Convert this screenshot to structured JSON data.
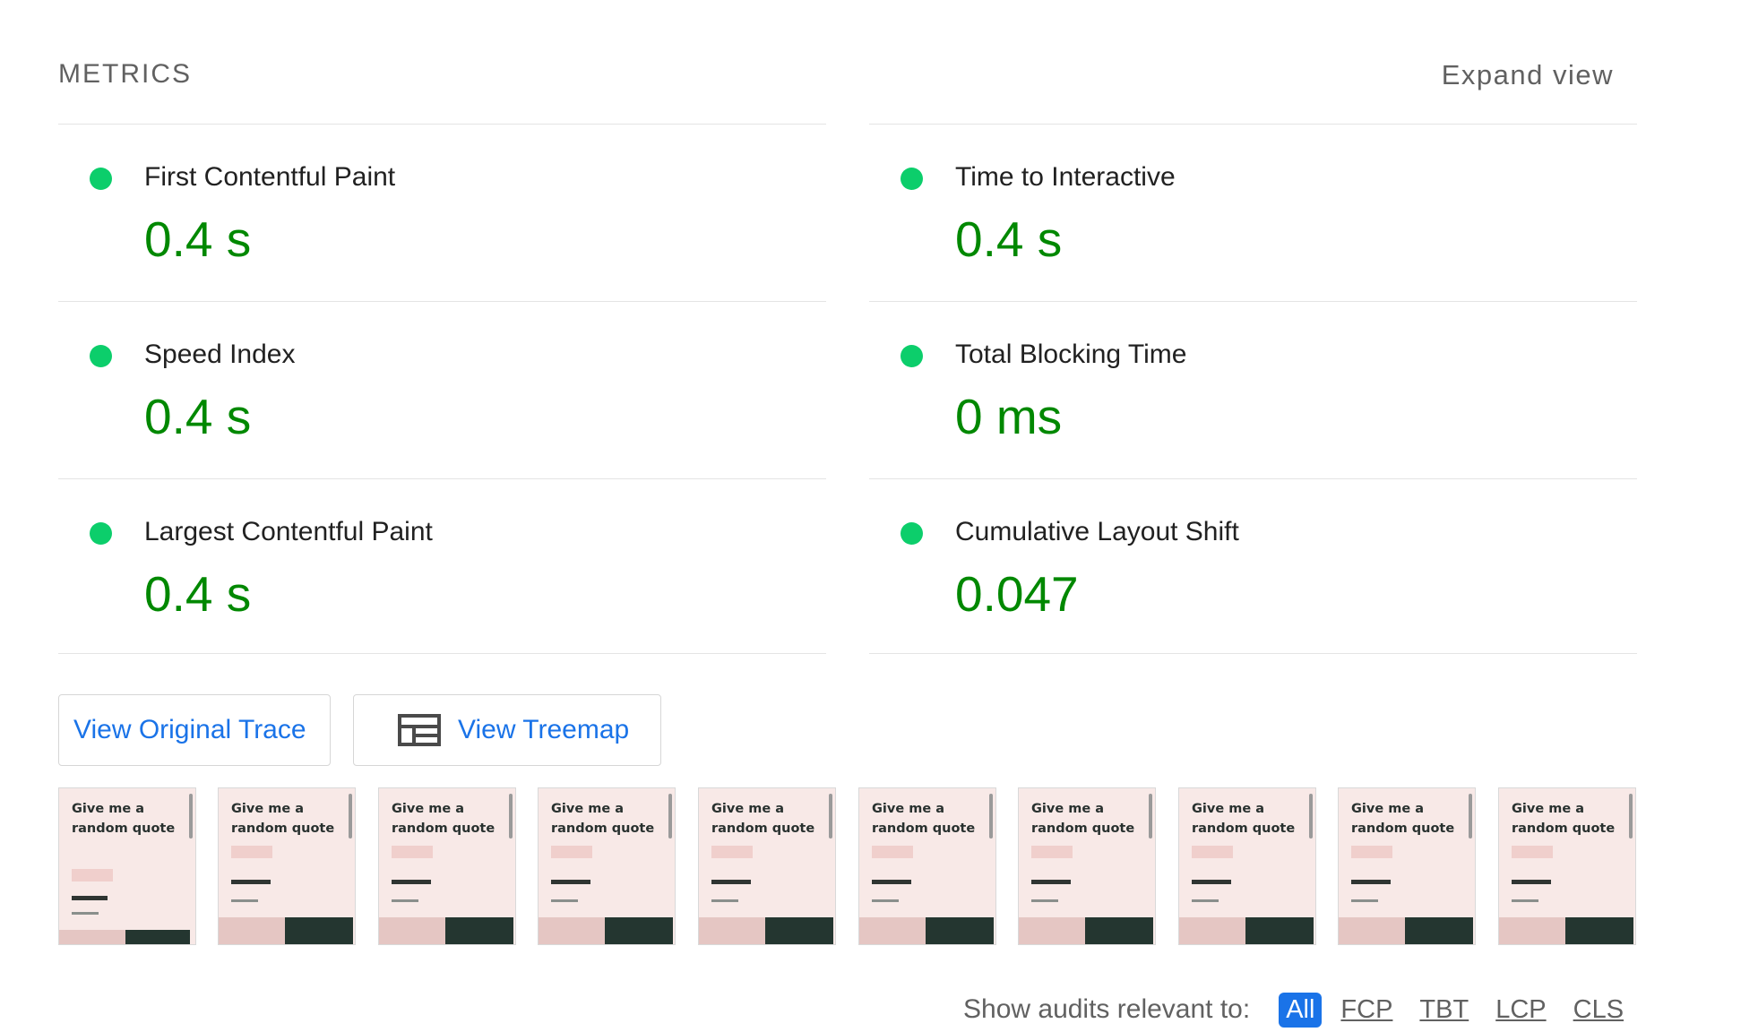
{
  "header": {
    "title": "METRICS",
    "expand_label": "Expand view"
  },
  "metrics": [
    {
      "label": "First Contentful Paint",
      "value": "0.4 s",
      "status": "pass"
    },
    {
      "label": "Time to Interactive",
      "value": "0.4 s",
      "status": "pass"
    },
    {
      "label": "Speed Index",
      "value": "0.4 s",
      "status": "pass"
    },
    {
      "label": "Total Blocking Time",
      "value": "0 ms",
      "status": "pass"
    },
    {
      "label": "Largest Contentful Paint",
      "value": "0.4 s",
      "status": "pass"
    },
    {
      "label": "Cumulative Layout Shift",
      "value": "0.047",
      "status": "pass"
    }
  ],
  "buttons": {
    "trace_label": "View Original Trace",
    "treemap_label": "View Treemap",
    "treemap_icon": "treemap-icon"
  },
  "filmstrip": {
    "frames": [
      {
        "title": "Give me a random quote"
      },
      {
        "title": "Give me a random quote"
      },
      {
        "title": "Give me a random quote"
      },
      {
        "title": "Give me a random quote"
      },
      {
        "title": "Give me a random quote"
      },
      {
        "title": "Give me a random quote"
      },
      {
        "title": "Give me a random quote"
      },
      {
        "title": "Give me a random quote"
      },
      {
        "title": "Give me a random quote"
      },
      {
        "title": "Give me a random quote"
      }
    ]
  },
  "audit_filter": {
    "label": "Show audits relevant to:",
    "options": [
      "All",
      "FCP",
      "TBT",
      "LCP",
      "CLS"
    ],
    "selected": "All"
  },
  "colors": {
    "pass_dot": "#0cce6b",
    "pass_value": "#008800",
    "link_blue": "#1a73e8",
    "divider": "#e4e4e4",
    "frame_background": "#f8e9e7",
    "frame_dark_panel": "#243630"
  }
}
